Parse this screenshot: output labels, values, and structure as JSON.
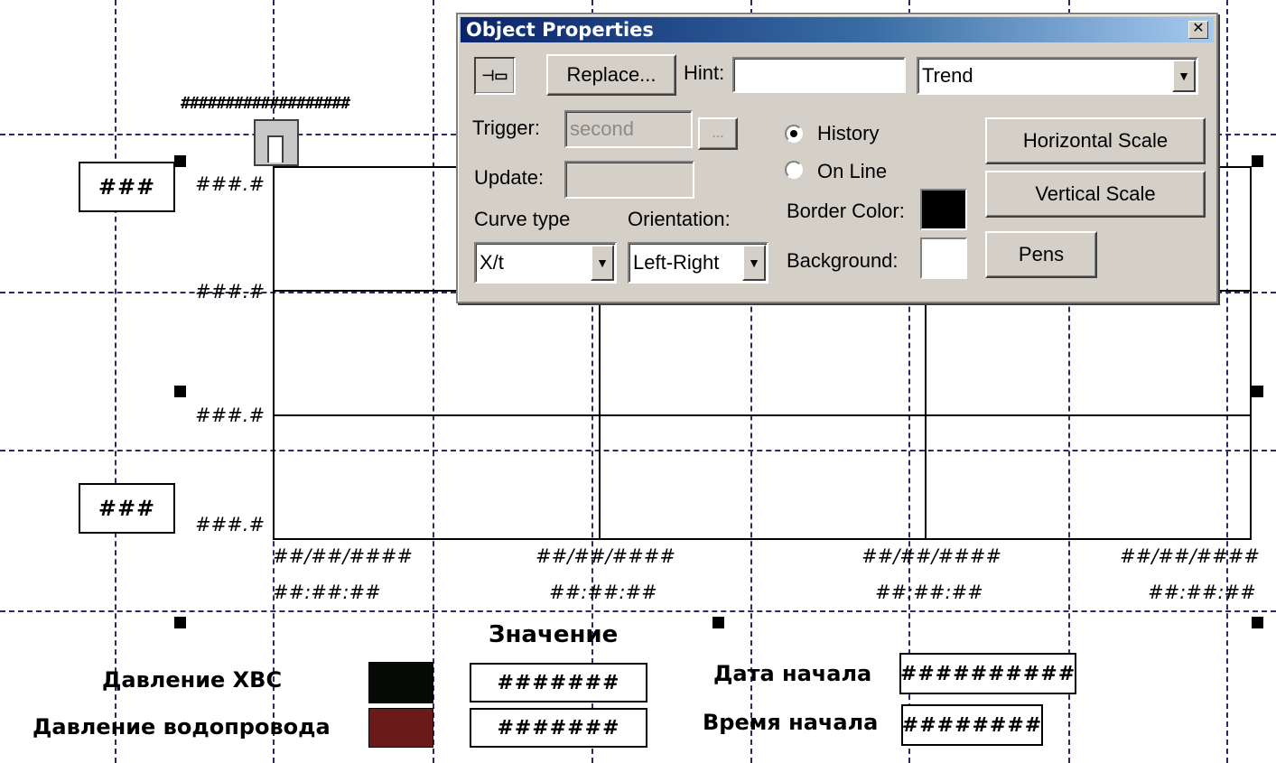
{
  "canvas": {
    "top_hash_bar": "###################",
    "value_box_top": "###",
    "value_box_bottom": "###",
    "y_axis_labels": [
      "###.#",
      "###.#",
      "###.#",
      "###.#"
    ],
    "x_axis_labels": [
      {
        "date": "##/##/####",
        "time": "##:##:##"
      },
      {
        "date": "##/##/####",
        "time": "##:##:##"
      },
      {
        "date": "##/##/####",
        "time": "##:##:##"
      },
      {
        "date": "##/##/####",
        "time": "##:##:##"
      }
    ]
  },
  "legend": {
    "value_header": "Значение",
    "rows": [
      {
        "label": "Давление ХВС",
        "color": "#050a05",
        "value": "#######"
      },
      {
        "label": "Давление водопровода",
        "color": "#6b1a1a",
        "value": "#######"
      }
    ],
    "start_date_label": "Дата начала",
    "start_date_value": "##########",
    "start_time_label": "Время начала",
    "start_time_value": "########"
  },
  "dialog": {
    "title": "Object Properties",
    "close_glyph": "✕",
    "pin_glyph": "⊣▭",
    "replace_label": "Replace...",
    "hint_label": "Hint:",
    "hint_value": "",
    "type_value": "Trend",
    "trigger_label": "Trigger:",
    "trigger_value": "second",
    "browse_label": "...",
    "update_label": "Update:",
    "update_value": "",
    "curve_type_label": "Curve type",
    "curve_type_value": "X/t",
    "orientation_label": "Orientation:",
    "orientation_value": "Left-Right",
    "history_label": "History",
    "online_label": "On Line",
    "border_color_label": "Border Color:",
    "border_color": "#000000",
    "background_label": "Background:",
    "background_color": "#ffffff",
    "horizontal_scale_label": "Horizontal Scale",
    "vertical_scale_label": "Vertical Scale",
    "pens_label": "Pens"
  }
}
